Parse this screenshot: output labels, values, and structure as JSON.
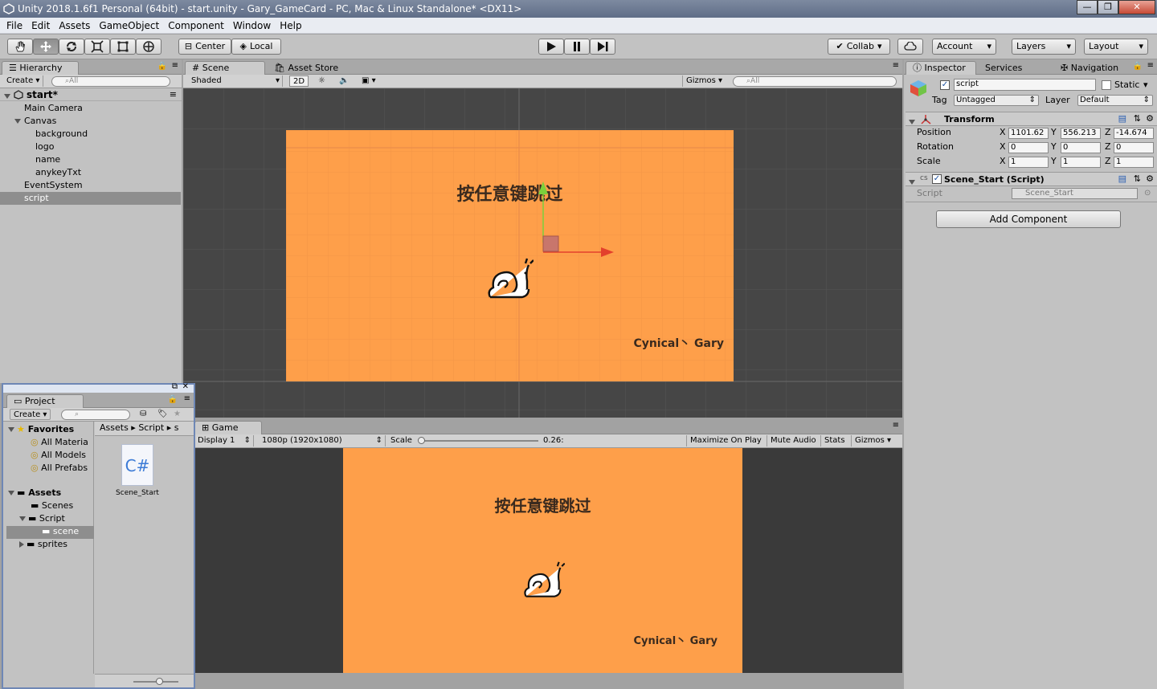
{
  "window": {
    "title": "Unity 2018.1.6f1 Personal (64bit) - start.unity - Gary_GameCard - PC, Mac & Linux Standalone* <DX11>",
    "minimize": "—",
    "maximize": "❐",
    "close": "✕"
  },
  "menu": [
    "File",
    "Edit",
    "Assets",
    "GameObject",
    "Component",
    "Window",
    "Help"
  ],
  "toolbar": {
    "pivot": "Center",
    "space": "Local",
    "collab": "Collab",
    "account": "Account",
    "layers": "Layers",
    "layout": "Layout"
  },
  "hierarchy": {
    "tab": "Hierarchy",
    "create": "Create",
    "search": "All",
    "scene": "start*",
    "items": [
      {
        "label": "Main Camera",
        "indent": 1
      },
      {
        "label": "Canvas",
        "indent": 1,
        "expanded": true
      },
      {
        "label": "background",
        "indent": 2
      },
      {
        "label": "logo",
        "indent": 2
      },
      {
        "label": "name",
        "indent": 2
      },
      {
        "label": "anykeyTxt",
        "indent": 2
      },
      {
        "label": "EventSystem",
        "indent": 1
      },
      {
        "label": "script",
        "indent": 1,
        "selected": true
      }
    ]
  },
  "scene": {
    "tab": "Scene",
    "asset_store": "Asset Store",
    "shading": "Shaded",
    "mode2d": "2D",
    "gizmos": "Gizmos",
    "search": "All",
    "heading": "按任意键跳过",
    "credit": "Cynical丶 Gary",
    "bg_color": "#fe9f4a",
    "view_bg": "#464646"
  },
  "game": {
    "tab": "Game",
    "display": "Display 1",
    "resolution": "1080p (1920x1080)",
    "scale_label": "Scale",
    "scale_value": "0.26:",
    "maximize": "Maximize On Play",
    "mute": "Mute Audio",
    "stats": "Stats",
    "gizmos": "Gizmos",
    "heading": "按任意键跳过",
    "credit": "Cynical丶 Gary"
  },
  "project": {
    "tab": "Project",
    "create": "Create",
    "favorites": "Favorites",
    "fav_items": [
      "All Materia",
      "All Models",
      "All Prefabs"
    ],
    "assets": "Assets",
    "asset_items": [
      "Scenes",
      "Script",
      "scene",
      "sprites"
    ],
    "breadcrumb": [
      "Assets",
      "Script",
      "s"
    ],
    "file_name": "Scene_Start",
    "file_icon_text": "C#"
  },
  "inspector": {
    "tab": "Inspector",
    "services": "Services",
    "navigation": "Navigation",
    "object_name": "script",
    "static": "Static",
    "tag_label": "Tag",
    "tag_value": "Untagged",
    "layer_label": "Layer",
    "layer_value": "Default",
    "transform": {
      "title": "Transform",
      "rows": [
        {
          "label": "Position",
          "x": "1101.62",
          "y": "556.213",
          "z": "-14.674"
        },
        {
          "label": "Rotation",
          "x": "0",
          "y": "0",
          "z": "0"
        },
        {
          "label": "Scale",
          "x": "1",
          "y": "1",
          "z": "1"
        }
      ]
    },
    "script_comp": {
      "title": "Scene_Start (Script)",
      "field_label": "Script",
      "field_value": "Scene_Start"
    },
    "add_component": "Add Component"
  }
}
